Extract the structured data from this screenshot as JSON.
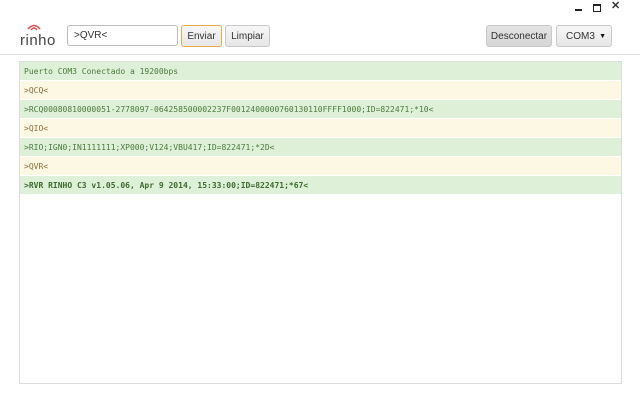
{
  "app": {
    "logo_text": "rinho"
  },
  "window": {
    "minimize": "",
    "maximize": "",
    "close": "✕"
  },
  "toolbar": {
    "command_value": ">QVR<",
    "send_label": "Enviar",
    "clear_label": "Limpiar",
    "disconnect_label": "Desconectar",
    "port_selected": "COM3"
  },
  "console": {
    "lines": [
      {
        "text": "Puerto COM3 Conectado a 19200bps",
        "kind": "rx"
      },
      {
        "text": ">QCQ<",
        "kind": "tx"
      },
      {
        "text": ">RCQ00080810000051-2778097-064258500002237F0012400000760130110FFFF1000;ID=822471;*10<",
        "kind": "rx"
      },
      {
        "text": ">QIO<",
        "kind": "tx"
      },
      {
        "text": ">RIO;IGN0;IN1111111;XP000;V124;VBU417;ID=822471;*2D<",
        "kind": "rx"
      },
      {
        "text": ">QVR<",
        "kind": "tx"
      },
      {
        "text": ">RVR RINHO C3 v1.05.06, Apr 9 2014, 15:33:00;ID=822471;*67<",
        "kind": "rx-bold"
      }
    ]
  },
  "colors": {
    "rx_bg": "#dff0d8",
    "tx_bg": "#fcf8e3",
    "accent_border": "#e8a94a"
  }
}
